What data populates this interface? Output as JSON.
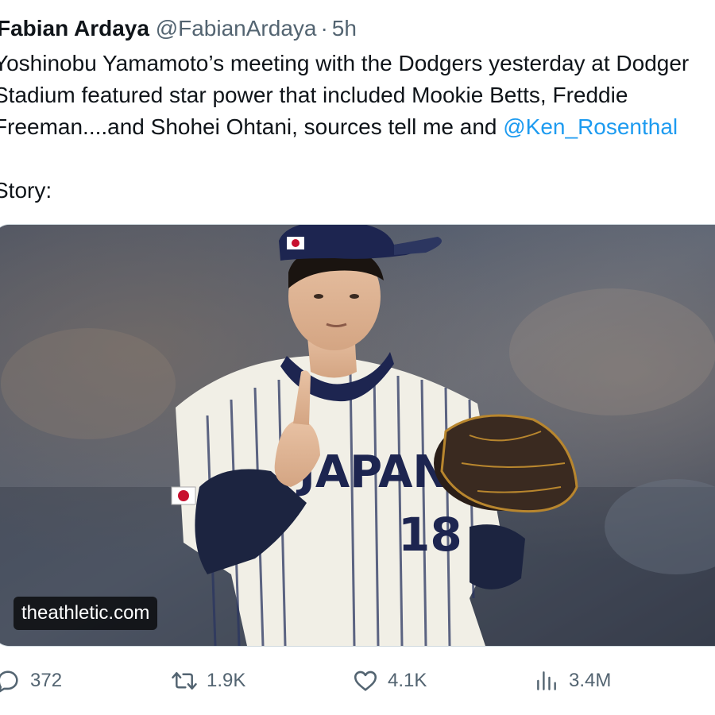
{
  "author": {
    "name": "Fabian Ardaya",
    "handle": "@FabianArdaya",
    "separator": "·",
    "time": "5h"
  },
  "body": {
    "line1": "Yoshinobu Yamamoto’s meeting with the Dodgers yesterday at Dodger",
    "line2": "Stadium featured star power that included Mookie Betts, Freddie",
    "line3_prefix": "Freeman....and Shohei Ohtani, sources tell me and ",
    "mention": "@Ken_Rosenthal",
    "line4": "Story:"
  },
  "media": {
    "link_label": "theathletic.com",
    "jersey_text": "JAPAN",
    "jersey_number": "18"
  },
  "actions": {
    "replies": "372",
    "reposts": "1.9K",
    "likes": "4.1K",
    "views": "3.4M"
  },
  "colors": {
    "link": "#1d9bf0",
    "secondary_text": "#536471",
    "primary_text": "#0f1419"
  }
}
